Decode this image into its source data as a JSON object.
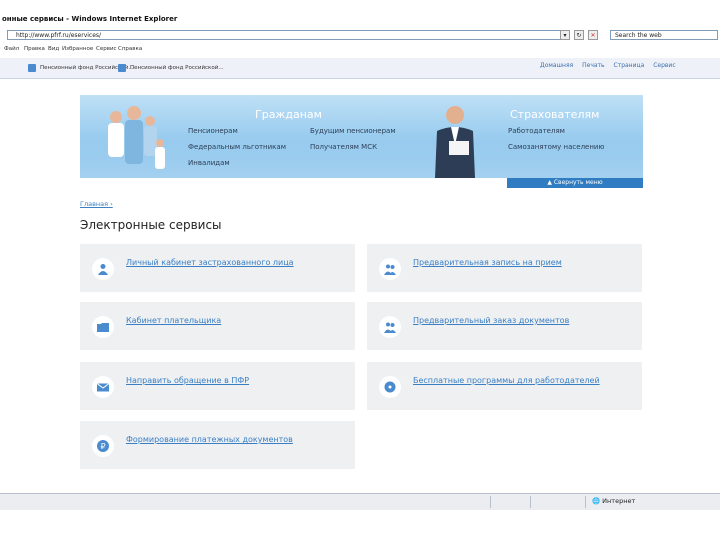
{
  "browser": {
    "title": "онные сервисы - Windows Internet Explorer",
    "address": "http://www.pfrf.ru/eservices/",
    "search_placeholder": "Search the web",
    "menu": [
      "Файл",
      "Правка",
      "Вид",
      "Избранное",
      "Сервис",
      "Справка"
    ],
    "tabs": [
      "Пенсионный фонд Российской...",
      "Пенсионный фонд Российской..."
    ],
    "tools": [
      "Домашняя",
      "Печать",
      "Страница",
      "Сервис"
    ]
  },
  "banner": {
    "citizens_heading": "Гражданам",
    "insurers_heading": "Страхователям",
    "citizens_links_col1": [
      "Пенсионерам",
      "Федеральным льготникам",
      "Инвалидам"
    ],
    "citizens_links_col2": [
      "Будущим пенсионерам",
      "Получателям МСК"
    ],
    "insurers_links": [
      "Работодателям",
      "Самозанятому населению"
    ],
    "collapse_label": "Свернуть меню"
  },
  "breadcrumb": "Главная",
  "page_title": "Электронные сервисы",
  "services": [
    {
      "label": "Личный кабинет застрахованного лица",
      "icon": "person-icon"
    },
    {
      "label": "Предварительная запись на прием",
      "icon": "people-icon"
    },
    {
      "label": "Кабинет плательщика",
      "icon": "folder-icon"
    },
    {
      "label": "Предварительный заказ документов",
      "icon": "people-icon"
    },
    {
      "label": "Направить обращение в ПФР",
      "icon": "mail-icon"
    },
    {
      "label": "Бесплатные программы для работодателей",
      "icon": "disk-icon"
    },
    {
      "label": "Формирование платежных документов",
      "icon": "ruble-icon"
    }
  ],
  "statusbar": {
    "zone": "Интернет"
  },
  "colors": {
    "accent": "#3a7fc4",
    "banner_top": "#bfe0f6",
    "banner_bottom": "#74b8e8",
    "card_bg": "#eef0f2"
  }
}
